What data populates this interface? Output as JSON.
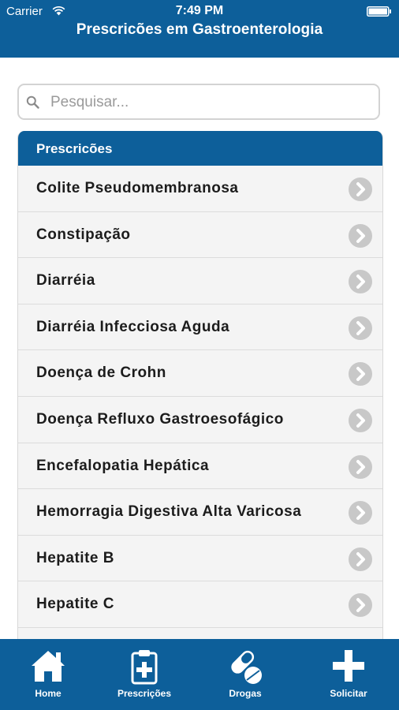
{
  "status_bar": {
    "carrier": "Carrier",
    "time": "7:49 PM"
  },
  "nav": {
    "title": "Prescricões em Gastroenterologia"
  },
  "search": {
    "placeholder": "Pesquisar..."
  },
  "section": {
    "title": "Prescricões"
  },
  "items": [
    {
      "label": "Colite Pseudomembranosa"
    },
    {
      "label": "Constipação"
    },
    {
      "label": "Diarréia"
    },
    {
      "label": "Diarréia Infecciosa Aguda"
    },
    {
      "label": "Doença de Crohn"
    },
    {
      "label": "Doença Refluxo Gastroesofágico"
    },
    {
      "label": "Encefalopatia Hepática"
    },
    {
      "label": "Hemorragia Digestiva Alta Varicosa"
    },
    {
      "label": "Hepatite B"
    },
    {
      "label": "Hepatite C"
    }
  ],
  "tabs": [
    {
      "label": "Home",
      "icon": "home-icon"
    },
    {
      "label": "Prescrições",
      "icon": "clipboard-icon"
    },
    {
      "label": "Drogas",
      "icon": "pills-icon"
    },
    {
      "label": "Solicitar",
      "icon": "plus-icon"
    }
  ],
  "colors": {
    "brand_blue": "#0d5f9a",
    "row_bg": "#f4f4f4",
    "chevron_grey": "#c8c8c8"
  }
}
